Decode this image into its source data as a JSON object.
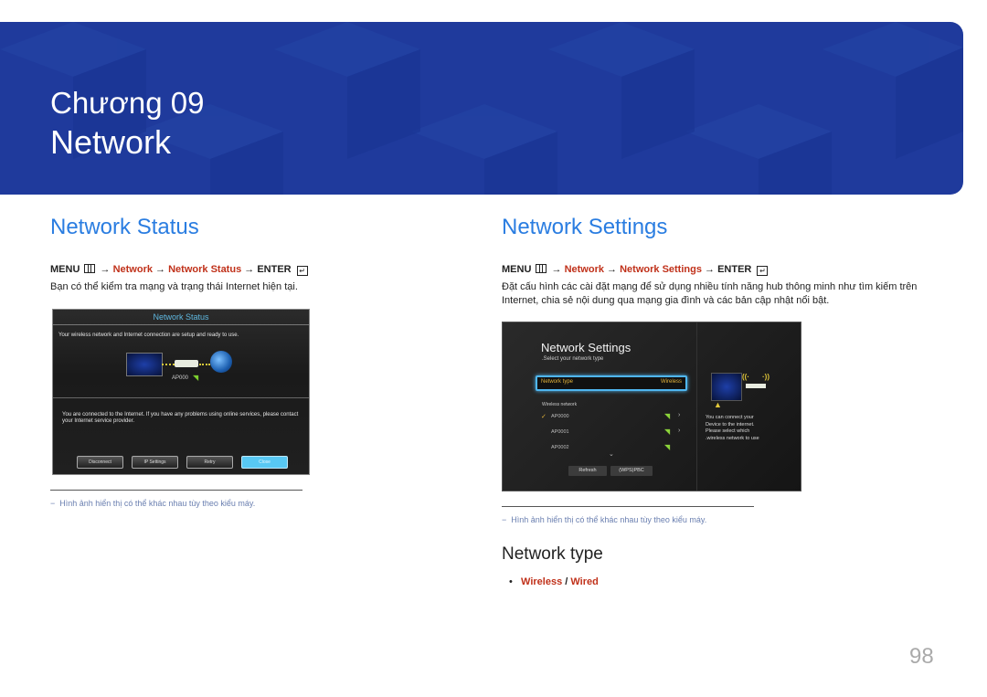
{
  "banner": {
    "chapter": "Chương 09",
    "title": "Network",
    "color": "#1f3a9c"
  },
  "network_status": {
    "heading": "Network Status",
    "menu_path": {
      "menu": "MENU",
      "menu_icon": "menu-grid-icon",
      "step1": "Network",
      "step2": "Network Status",
      "enter": "ENTER",
      "enter_icon": "enter-icon",
      "arrow": "→"
    },
    "description": "Bạn có thể kiểm tra mạng và trạng thái Internet hiện tại.",
    "screenshot": {
      "title": "Network Status",
      "message": "Your wireless network and Internet connection are setup and ready to use.",
      "ap_name": "AP000",
      "status_message": "You are connected to the Internet. If you have any problems using online services, please contact your Internet service provider.",
      "buttons": [
        "Disconnect",
        "IP Settings",
        "Retry",
        "Close"
      ]
    },
    "note": "Hình ảnh hiển thị có thể khác nhau tùy theo kiểu máy."
  },
  "network_settings": {
    "heading": "Network Settings",
    "menu_path": {
      "menu": "MENU",
      "menu_icon": "menu-grid-icon",
      "step1": "Network",
      "step2": "Network Settings",
      "enter": "ENTER",
      "enter_icon": "enter-icon",
      "arrow": "→"
    },
    "description": "Đặt cấu hình các cài đặt mạng để sử dụng nhiều tính năng hub thông minh như tìm kiếm trên Internet, chia sẻ nội dung qua mạng gia đình và các bản cập nhật nổi bật.",
    "screenshot": {
      "title": "Network Settings",
      "subtitle": ".Select your network type",
      "network_type_label": "Network type",
      "network_type_value": "Wireless",
      "wireless_network_label": "Wireless network",
      "networks": [
        {
          "name": "AP0000",
          "selected": true,
          "has_arrow": true
        },
        {
          "name": "AP0001",
          "selected": false,
          "has_arrow": true
        },
        {
          "name": "AP0002",
          "selected": false,
          "has_arrow": false
        }
      ],
      "buttons": [
        "Refresh",
        "(WPS)PBC"
      ],
      "help_text": [
        "You can connect your",
        "Device to the internet.",
        "Please select which",
        ".wireless network to use"
      ]
    },
    "note": "Hình ảnh hiển thị có thể khác nhau tùy theo kiểu máy."
  },
  "network_type": {
    "heading": "Network type",
    "options": {
      "wireless": "Wireless",
      "separator": " / ",
      "wired": "Wired"
    }
  },
  "page_number": "98",
  "colors": {
    "heading_blue": "#2a7de1",
    "accent_red": "#c0311a",
    "note_blue": "#6a7fb0"
  }
}
